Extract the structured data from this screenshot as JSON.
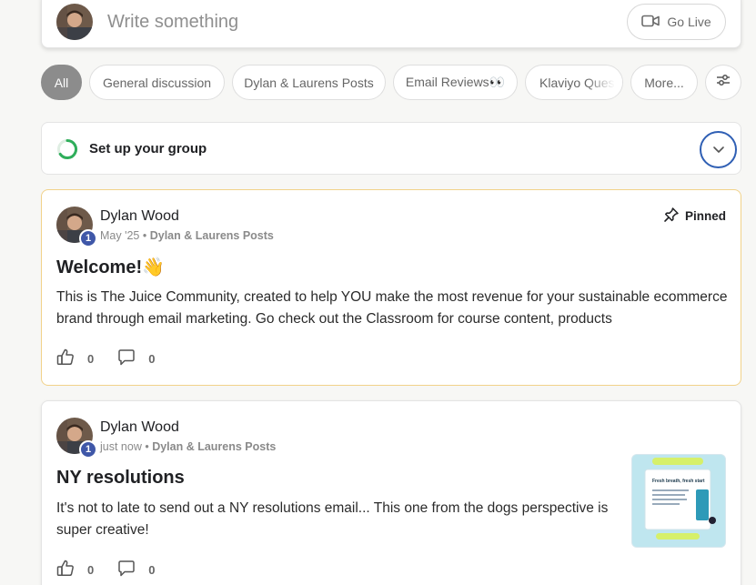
{
  "composer": {
    "placeholder": "Write something",
    "go_live": "Go Live"
  },
  "filters": {
    "chips": [
      "All",
      "General discussion",
      "Dylan & Laurens Posts",
      "Email Reviews👀",
      "Klaviyo Questi",
      "More..."
    ]
  },
  "setup": {
    "title": "Set up your group"
  },
  "posts": [
    {
      "author": "Dylan Wood",
      "level": "1",
      "time": "May '25",
      "category": "Dylan & Laurens Posts",
      "pinned_label": "Pinned",
      "title": "Welcome!👋",
      "body": "This is The Juice Community, created to help YOU make the most revenue for your sustainable ecommerce brand through email marketing. Go check out the Classroom for course content, products",
      "likes": "0",
      "comments": "0"
    },
    {
      "author": "Dylan Wood",
      "level": "1",
      "time": "just now",
      "category": "Dylan & Laurens Posts",
      "title": "NY resolutions",
      "body": "It's not to late to send out a NY resolutions email... This one from the dogs perspective is super creative!",
      "likes": "0",
      "comments": "0",
      "thumbnail_text": "Fresh breath, fresh start"
    }
  ],
  "colors": {
    "accent": "#2f5fb4",
    "badge": "#3f57a8",
    "pinned_border": "#f1d28a",
    "progress": "#2fae5b"
  }
}
